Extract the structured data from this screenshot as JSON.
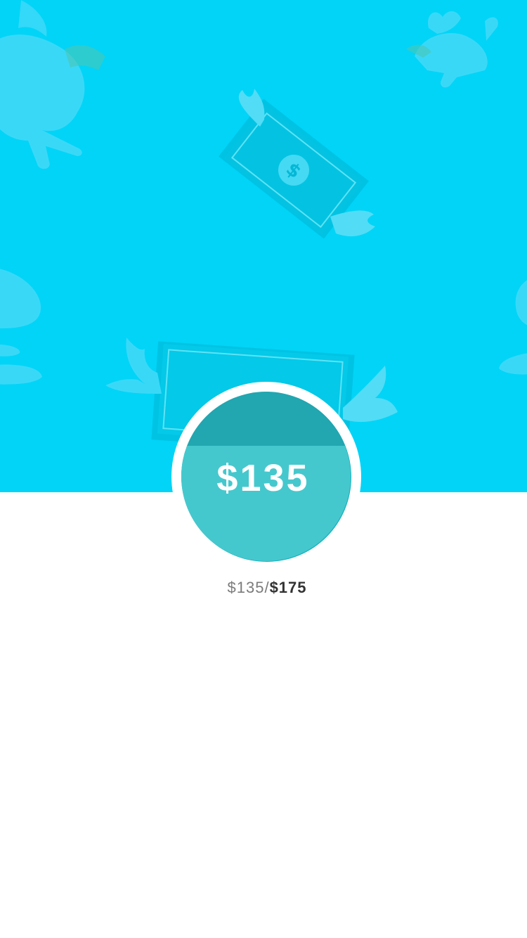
{
  "theme": {
    "hero_color": "#01d4f7",
    "track_color": "#22a6b0",
    "fill_color": "#45c8cd"
  },
  "hero": {
    "illustrations": [
      "pegasus-icon",
      "pegasus-icon",
      "winged-dollar-bill-icon",
      "winged-dollar-bill-icon"
    ]
  },
  "progress": {
    "amount_label": "$135",
    "current_label": "$135",
    "separator": "/",
    "goal_label": "$175",
    "fraction": 0.68
  }
}
